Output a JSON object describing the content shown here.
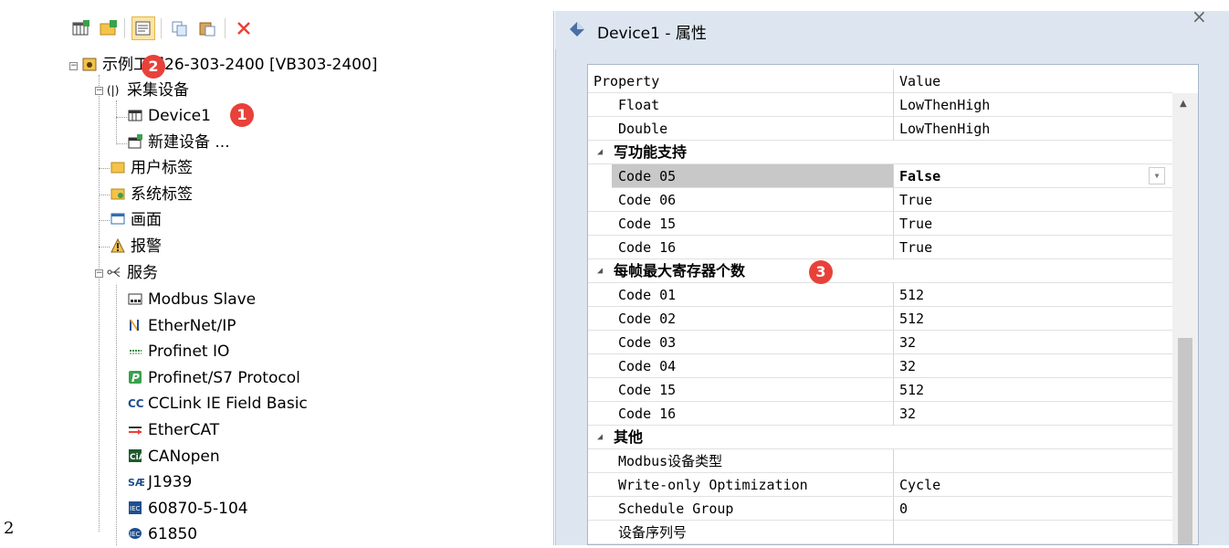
{
  "page_marker": "2",
  "toolbar": {
    "buttons": [
      "grid-add-icon",
      "folder-add-icon",
      "properties-icon",
      "copy-icon",
      "paste-icon",
      "delete-icon"
    ]
  },
  "tree": {
    "root": "示例工程26-303-2400 [VB303-2400]",
    "collect_devices": "采集设备",
    "device1": "Device1",
    "new_device": "新建设备 ...",
    "user_tags": "用户标签",
    "system_tags": "系统标签",
    "screens": "画面",
    "alarms": "报警",
    "services": "服务",
    "service_items": [
      "Modbus Slave",
      "EtherNet/IP",
      "Profinet IO",
      "Profinet/S7 Protocol",
      "CCLink IE Field Basic",
      "EtherCAT",
      "CANopen",
      "J1939",
      "60870-5-104",
      "61850"
    ]
  },
  "badges": {
    "b1": "1",
    "b2": "2",
    "b3": "3"
  },
  "properties_panel": {
    "title": "Device1 - 属性",
    "close": "×",
    "header": {
      "property": "Property",
      "value": "Value"
    },
    "rows": [
      {
        "k": "Float",
        "v": "LowThenHigh"
      },
      {
        "k": "Double",
        "v": "LowThenHigh"
      }
    ],
    "cat_write": "写功能支持",
    "write_rows": [
      {
        "k": "Code 05",
        "v": "False"
      },
      {
        "k": "Code 06",
        "v": "True"
      },
      {
        "k": "Code 15",
        "v": "True"
      },
      {
        "k": "Code 16",
        "v": "True"
      }
    ],
    "cat_max": "每帧最大寄存器个数",
    "max_rows": [
      {
        "k": "Code 01",
        "v": "512"
      },
      {
        "k": "Code 02",
        "v": "512"
      },
      {
        "k": "Code 03",
        "v": "32"
      },
      {
        "k": "Code 04",
        "v": "32"
      },
      {
        "k": "Code 15",
        "v": "512"
      },
      {
        "k": "Code 16",
        "v": "32"
      }
    ],
    "cat_other": "其他",
    "other_rows": [
      {
        "k": "Modbus设备类型",
        "v": ""
      },
      {
        "k": "Write-only Optimization",
        "v": "Cycle"
      },
      {
        "k": "Schedule Group",
        "v": "0"
      },
      {
        "k": "设备序列号",
        "v": ""
      }
    ]
  },
  "colors": {
    "badge": "#e8413a",
    "selected_row": "#c8c8c8",
    "panel_bg": "#dde6f0"
  }
}
